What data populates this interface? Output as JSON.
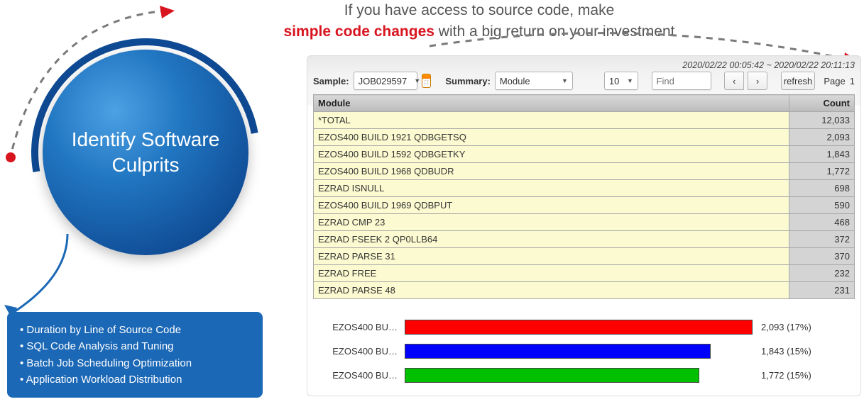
{
  "headline": {
    "line1": "If you have access to source code, make",
    "emph": "simple code changes",
    "line2_rest": " with a big return on your investment"
  },
  "circle_title": "Identify Software Culprits",
  "features": [
    "Duration by Line of Source Code",
    "SQL Code Analysis and Tuning",
    "Batch Job Scheduling Optimization",
    "Application Workload Distribution"
  ],
  "panel": {
    "timestamp": "2020/02/22 00:05:42 ~ 2020/02/22 20:11:13",
    "labels": {
      "sample": "Sample:",
      "summary": "Summary:",
      "page": "Page",
      "find_placeholder": "Find",
      "refresh": "refresh",
      "prev_glyph": "‹",
      "next_glyph": "›"
    },
    "sample_value": "JOB029597",
    "summary_value": "Module",
    "pagesize_value": "10",
    "page_number": "1",
    "columns": {
      "module": "Module",
      "count": "Count"
    },
    "rows": [
      {
        "module": "*TOTAL",
        "count": "12,033"
      },
      {
        "module": "EZOS400 BUILD 1921 QDBGETSQ",
        "count": "2,093"
      },
      {
        "module": "EZOS400 BUILD 1592 QDBGETKY",
        "count": "1,843"
      },
      {
        "module": "EZOS400 BUILD 1968 QDBUDR",
        "count": "1,772"
      },
      {
        "module": "EZRAD ISNULL",
        "count": "698"
      },
      {
        "module": "EZOS400 BUILD 1969 QDBPUT",
        "count": "590"
      },
      {
        "module": "EZRAD CMP 23",
        "count": "468"
      },
      {
        "module": "EZRAD FSEEK 2 QP0LLB64",
        "count": "372"
      },
      {
        "module": "EZRAD PARSE 31",
        "count": "370"
      },
      {
        "module": "EZRAD FREE",
        "count": "232"
      },
      {
        "module": "EZRAD PARSE 48",
        "count": "231"
      }
    ]
  },
  "chart_data": {
    "type": "bar",
    "orientation": "horizontal",
    "title": "",
    "xlabel": "",
    "ylabel": "",
    "xlim": [
      0,
      2093
    ],
    "categories": [
      "EZOS400 BU…",
      "EZOS400 BU…",
      "EZOS400 BU…"
    ],
    "series": [
      {
        "name": "count",
        "values": [
          2093,
          1843,
          1772
        ]
      }
    ],
    "value_labels": [
      "2,093 (17%)",
      "1,843 (15%)",
      "1,772 (15%)"
    ],
    "colors": [
      "#ff0000",
      "#0000ff",
      "#00c000"
    ]
  }
}
